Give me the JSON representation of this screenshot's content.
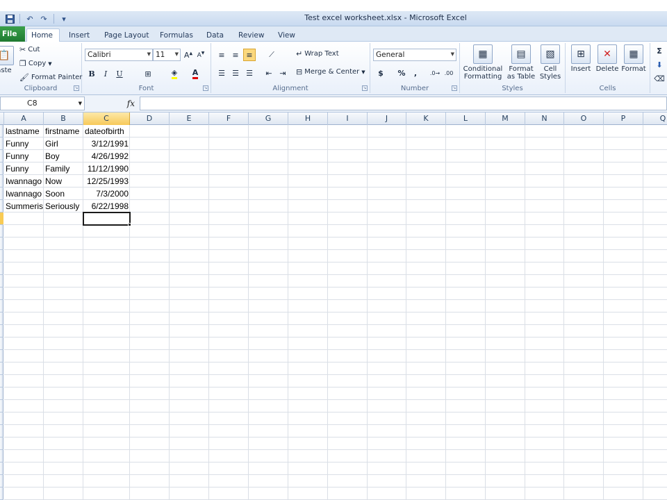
{
  "window": {
    "title": "Test excel worksheet.xlsx - Microsoft Excel"
  },
  "ribbon_tabs": [
    "File",
    "Home",
    "Insert",
    "Page Layout",
    "Formulas",
    "Data",
    "Review",
    "View"
  ],
  "active_tab": "Home",
  "clipboard": {
    "paste": "aste",
    "cut": "Cut",
    "copy": "Copy",
    "format_painter": "Format Painter",
    "label": "Clipboard"
  },
  "font": {
    "name": "Calibri",
    "size": "11",
    "bold": "B",
    "italic": "I",
    "underline": "U",
    "label": "Font"
  },
  "alignment": {
    "wrap_text": "Wrap Text",
    "merge_center": "Merge & Center",
    "label": "Alignment"
  },
  "number": {
    "format": "General",
    "currency": "$",
    "percent": "%",
    "comma": ",",
    "label": "Number"
  },
  "styles": {
    "conditional_formatting_1": "Conditional",
    "conditional_formatting_2": "Formatting",
    "format_as_table_1": "Format",
    "format_as_table_2": "as Table",
    "cell_styles_1": "Cell",
    "cell_styles_2": "Styles",
    "label": "Styles"
  },
  "cells_group": {
    "insert": "Insert",
    "delete": "Delete",
    "format": "Format",
    "label": "Cells"
  },
  "editing": {
    "sum": "Σ"
  },
  "formula_bar": {
    "name_box": "C8",
    "fx": "fx",
    "content": ""
  },
  "columns": [
    "A",
    "B",
    "C",
    "D",
    "E",
    "F",
    "G",
    "H",
    "I",
    "J",
    "K",
    "L",
    "M",
    "N",
    "O",
    "P",
    "Q"
  ],
  "selected_column": "C",
  "selected_row": 8,
  "rows": [
    [
      "lastname",
      "firstname",
      "dateofbirth"
    ],
    [
      "Funny",
      "Girl",
      "3/12/1991"
    ],
    [
      "Funny",
      "Boy",
      "4/26/1992"
    ],
    [
      "Funny",
      "Family",
      "11/12/1990"
    ],
    [
      "Iwannago",
      "Now",
      "12/25/1993"
    ],
    [
      "Iwannago",
      "Soon",
      "7/3/2000"
    ],
    [
      "Summeris",
      "Seriously",
      "6/22/1998"
    ]
  ],
  "colors": {
    "file_tab": "#1e7a31",
    "selection_header": "#f7c95a"
  }
}
